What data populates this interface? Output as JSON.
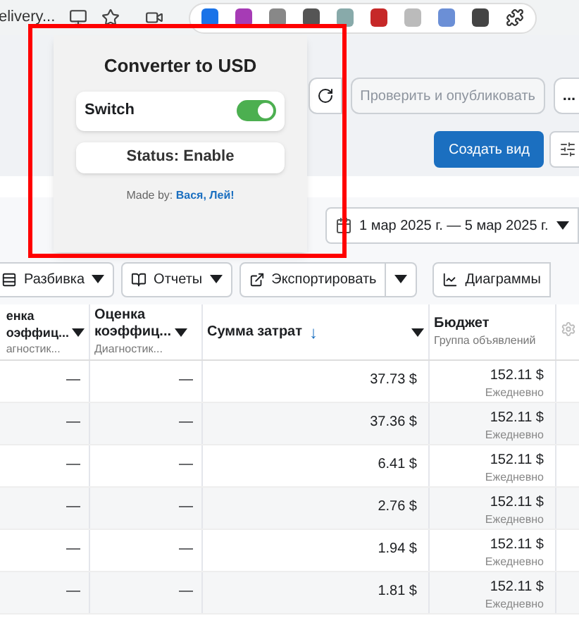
{
  "browser": {
    "tab_title": "elivery..."
  },
  "popup": {
    "title": "Converter to USD",
    "switch": {
      "label": "Switch",
      "on": true
    },
    "status": "Status: Enable",
    "credit": {
      "prefix": "Made by:",
      "link": "Вася, Лей!"
    }
  },
  "header_actions": {
    "publish": "Проверить и опубликовать",
    "more": "...",
    "create_view": "Создать вид"
  },
  "date_range": "1 мар 2025 г. — 5 мар 2025 г.",
  "toolbar": {
    "breakdown": "Разбивка",
    "reports": "Отчеты",
    "export": "Экспортировать",
    "charts": "Диаграммы"
  },
  "table": {
    "columns": [
      {
        "title_lines": [
          "енка",
          "оэффиц..."
        ],
        "subtitle": "агностик..."
      },
      {
        "title_lines": [
          "Оценка",
          "коэффиц..."
        ],
        "subtitle": "Диагностик..."
      },
      {
        "title_lines": [
          "Сумма затрат"
        ],
        "sort_arrow": "↓"
      },
      {
        "title_lines": [
          "Бюджет"
        ],
        "subtitle": "Группа объявлений"
      }
    ],
    "rows": [
      {
        "col_1": "—",
        "col_2": "—",
        "spend": "37.73 $",
        "budget": "152.11 $",
        "budget_period": "Ежедневно"
      },
      {
        "col_1": "—",
        "col_2": "—",
        "spend": "37.36 $",
        "budget": "152.11 $",
        "budget_period": "Ежедневно"
      },
      {
        "col_1": "—",
        "col_2": "—",
        "spend": "6.41 $",
        "budget": "152.11 $",
        "budget_period": "Ежедневно"
      },
      {
        "col_1": "—",
        "col_2": "—",
        "spend": "2.76 $",
        "budget": "152.11 $",
        "budget_period": "Ежедневно"
      },
      {
        "col_1": "—",
        "col_2": "—",
        "spend": "1.94 $",
        "budget": "152.11 $",
        "budget_period": "Ежедневно"
      },
      {
        "col_1": "—",
        "col_2": "—",
        "spend": "1.81 $",
        "budget": "152.11 $",
        "budget_period": "Ежедневно"
      }
    ]
  }
}
